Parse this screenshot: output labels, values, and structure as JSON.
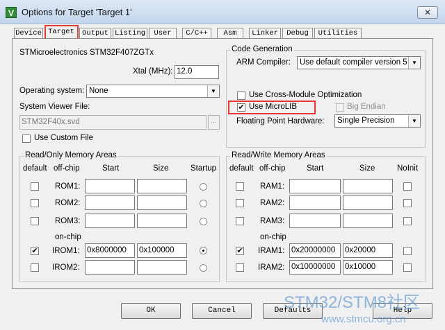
{
  "window": {
    "title": "Options for Target 'Target 1'",
    "close_glyph": "✕",
    "app_icon_glyph": "V"
  },
  "tabs": [
    {
      "label": "Device"
    },
    {
      "label": "Target"
    },
    {
      "label": "Output"
    },
    {
      "label": "Listing"
    },
    {
      "label": "User"
    },
    {
      "label": "C/C++"
    },
    {
      "label": "Asm"
    },
    {
      "label": "Linker"
    },
    {
      "label": "Debug"
    },
    {
      "label": "Utilities"
    }
  ],
  "device": {
    "name": "STMicroelectronics STM32F407ZGTx",
    "xtal_label": "Xtal (MHz):",
    "xtal_value": "12.0",
    "os_label": "Operating system:",
    "os_value": "None",
    "svd_label": "System Viewer File:",
    "svd_value": "STM32F40x.svd",
    "custom_file_label": "Use Custom File",
    "browse_label": "..."
  },
  "codegen": {
    "title": "Code Generation",
    "compiler_label": "ARM Compiler:",
    "compiler_value": "Use default compiler version 5",
    "cross_module_label": "Use Cross-Module Optimization",
    "microlib_label": "Use MicroLIB",
    "big_endian_label": "Big Endian",
    "fp_label": "Floating Point Hardware:",
    "fp_value": "Single Precision"
  },
  "rom": {
    "title": "Read/Only Memory Areas",
    "headers": {
      "default": "default",
      "offchip": "off-chip",
      "start": "Start",
      "size": "Size",
      "startup": "Startup"
    },
    "onchip_label": "on-chip",
    "rows": [
      {
        "label": "ROM1:",
        "start": "",
        "size": ""
      },
      {
        "label": "ROM2:",
        "start": "",
        "size": ""
      },
      {
        "label": "ROM3:",
        "start": "",
        "size": ""
      },
      {
        "label": "IROM1:",
        "start": "0x8000000",
        "size": "0x100000"
      },
      {
        "label": "IROM2:",
        "start": "",
        "size": ""
      }
    ]
  },
  "ram": {
    "title": "Read/Write Memory Areas",
    "headers": {
      "default": "default",
      "offchip": "off-chip",
      "start": "Start",
      "size": "Size",
      "noinit": "NoInit"
    },
    "onchip_label": "on-chip",
    "rows": [
      {
        "label": "RAM1:",
        "start": "",
        "size": ""
      },
      {
        "label": "RAM2:",
        "start": "",
        "size": ""
      },
      {
        "label": "RAM3:",
        "start": "",
        "size": ""
      },
      {
        "label": "IRAM1:",
        "start": "0x20000000",
        "size": "0x20000"
      },
      {
        "label": "IRAM2:",
        "start": "0x10000000",
        "size": "0x10000"
      }
    ]
  },
  "buttons": {
    "ok": "OK",
    "cancel": "Cancel",
    "defaults": "Defaults",
    "help": "Help"
  },
  "watermark": {
    "line1": "STM32/STM8社区",
    "line2": "www.stmcu.org.cn"
  },
  "checks": {
    "mark": "✔"
  },
  "colors": {
    "highlight": "#e53935",
    "watermark": "#6ea0d6"
  }
}
